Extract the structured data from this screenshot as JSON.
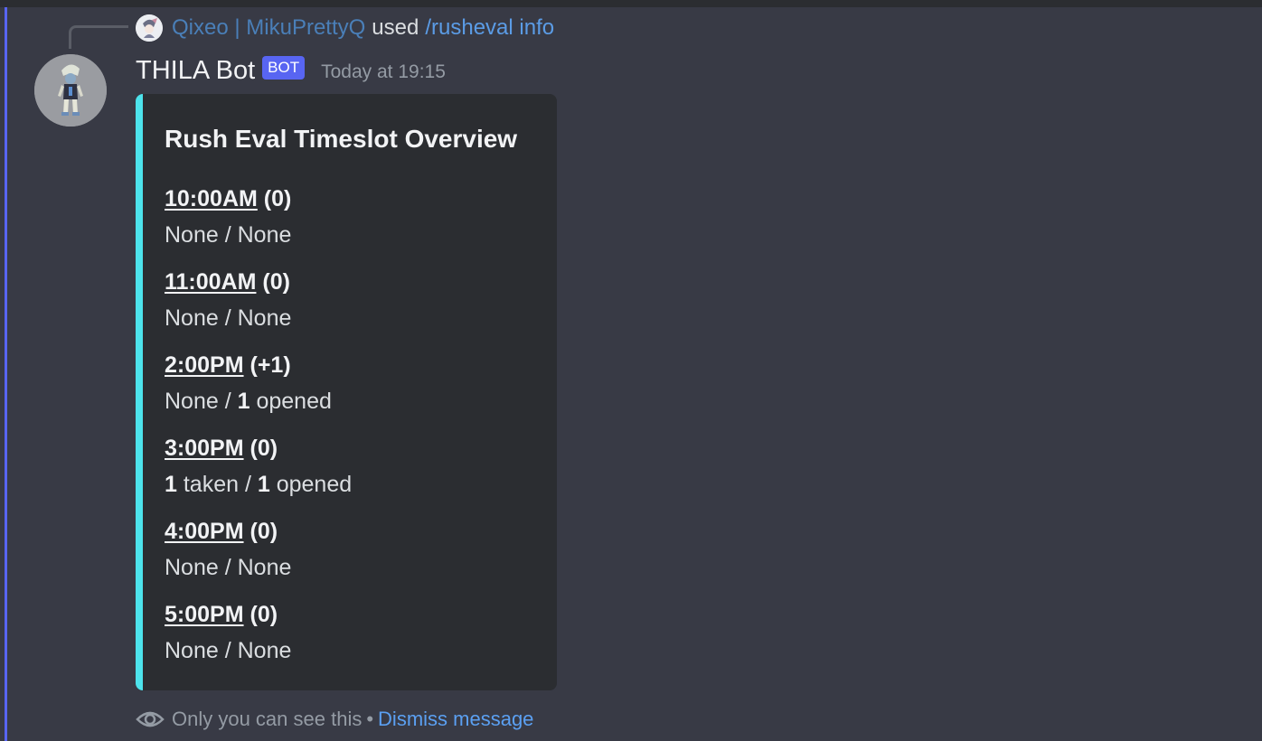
{
  "interaction": {
    "user": "Qixeo | MikuPrettyQ",
    "used_text": "used",
    "command": "/rusheval info"
  },
  "message": {
    "author": "THILA Bot",
    "badge": "BOT",
    "timestamp": "Today at 19:15"
  },
  "embed": {
    "accent_color": "#4de3ec",
    "title": "Rush Eval Timeslot Overview",
    "slots": [
      {
        "time": "10:00AM",
        "delta": "(0)",
        "taken": "None",
        "sep": " / ",
        "opened": "None"
      },
      {
        "time": "11:00AM",
        "delta": "(0)",
        "taken": "None",
        "sep": " / ",
        "opened": "None"
      },
      {
        "time": "2:00PM",
        "delta": "(+1)",
        "taken": "None",
        "sep": " / ",
        "opened_count": "1",
        "opened_suffix": " opened"
      },
      {
        "time": "3:00PM",
        "delta": "(0)",
        "taken_count": "1",
        "taken_suffix": " taken",
        "sep": " / ",
        "opened_count": "1",
        "opened_suffix": " opened"
      },
      {
        "time": "4:00PM",
        "delta": "(0)",
        "taken": "None",
        "sep": " / ",
        "opened": "None"
      },
      {
        "time": "5:00PM",
        "delta": "(0)",
        "taken": "None",
        "sep": " / ",
        "opened": "None"
      }
    ]
  },
  "footer": {
    "note": "Only you can see this",
    "separator": "•",
    "dismiss": "Dismiss message"
  },
  "colors": {
    "background": "#383a45",
    "accent": "#5865f2",
    "link": "#5ba0f2"
  }
}
